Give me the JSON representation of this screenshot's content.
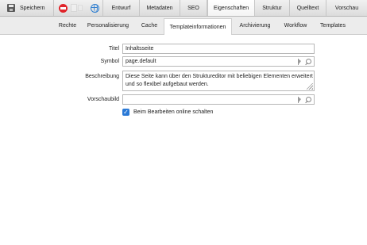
{
  "toolbar": {
    "save_label": "Speichern",
    "tabs": [
      {
        "label": "Entwurf"
      },
      {
        "label": "Metadaten"
      },
      {
        "label": "SEO"
      },
      {
        "label": "Eigenschaften",
        "active": true
      },
      {
        "label": "Struktur"
      },
      {
        "label": "Quelltext"
      },
      {
        "label": "Vorschau"
      }
    ],
    "icons": [
      "save-icon",
      "stop-icon",
      "document-icon",
      "globe-icon"
    ]
  },
  "subtabs": [
    {
      "label": "Rechte"
    },
    {
      "label": "Personalisierung"
    },
    {
      "label": "Cache"
    },
    {
      "label": "Templateinformationen",
      "active": true
    },
    {
      "label": "Archivierung"
    },
    {
      "label": "Workflow"
    },
    {
      "label": "Templates"
    }
  ],
  "form": {
    "title": {
      "label": "Titel",
      "value": "Inhaltsseite"
    },
    "symbol": {
      "label": "Symbol",
      "value": "page.default"
    },
    "description": {
      "label": "Beschreibung",
      "value": "Diese Seite kann über den Struktureditor mit beliebigen Elementen erweitert und so flexibel aufgebaut werden."
    },
    "preview_image": {
      "label": "Vorschaubild",
      "value": ""
    },
    "online_edit": {
      "label": "Beim Bearbeiten online schalten",
      "checked": true
    }
  },
  "colors": {
    "accent": "#2a79d6",
    "stop_red": "#e0242a",
    "toolbar_bg": "#e4e4e4"
  }
}
